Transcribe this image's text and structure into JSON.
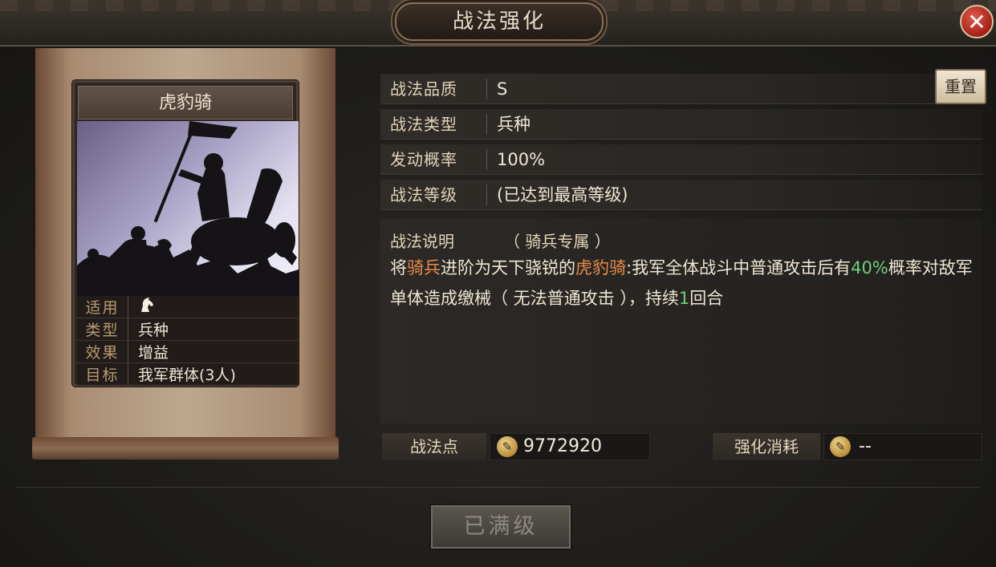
{
  "window": {
    "title": "战法强化"
  },
  "header": {
    "close_icon": "close-icon",
    "close_symbol": "✕"
  },
  "card": {
    "name": "虎豹骑",
    "rows": [
      {
        "key": "适用",
        "value": "",
        "icon": "horse-icon"
      },
      {
        "key": "类型",
        "value": "兵种"
      },
      {
        "key": "效果",
        "value": "增益"
      },
      {
        "key": "目标",
        "value": "我军群体(3人)"
      }
    ]
  },
  "info": {
    "quality_label": "战法品质",
    "quality_value": "S",
    "type_label": "战法类型",
    "type_value": "兵种",
    "rate_label": "发动概率",
    "rate_value": "100%",
    "level_label": "战法等级",
    "level_value": "(已达到最高等级)"
  },
  "reset_button": "重置",
  "description": {
    "label": "战法说明",
    "subtitle": "（ 骑兵专属 ）",
    "parts": [
      {
        "text": "将",
        "style": "plain"
      },
      {
        "text": "骑兵",
        "style": "orange"
      },
      {
        "text": "进阶为天下骁锐的",
        "style": "plain"
      },
      {
        "text": "虎豹骑",
        "style": "orange"
      },
      {
        "text": ":我军全体战斗中普通攻击后有",
        "style": "plain"
      },
      {
        "text": "40%",
        "style": "green"
      },
      {
        "text": "概率对敌军单体造成缴械（ 无法普通攻击 ），持续",
        "style": "plain"
      },
      {
        "text": "1",
        "style": "green"
      },
      {
        "text": "回合",
        "style": "plain"
      }
    ]
  },
  "points": {
    "label": "战法点",
    "value": "9772920",
    "icon": "tactic-point-icon"
  },
  "cost": {
    "label": "强化消耗",
    "value": "--",
    "icon": "tactic-point-icon"
  },
  "max_button": "已满级",
  "colors": {
    "accent_orange": "#e88b4a",
    "accent_green": "#6fcf7a",
    "close_red": "#c2281c"
  }
}
